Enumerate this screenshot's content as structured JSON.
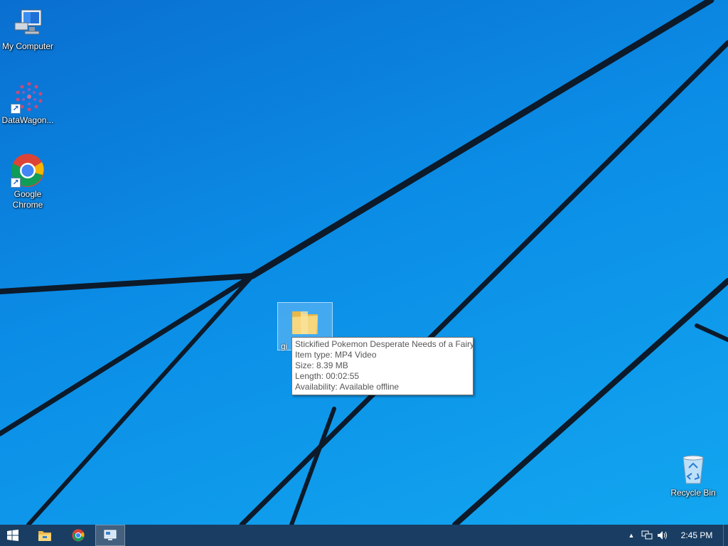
{
  "desktop": {
    "icons": [
      {
        "label": "My Computer"
      },
      {
        "label": "DataWagon..."
      },
      {
        "label": "Google Chrome"
      },
      {
        "label": "Recycle Bin"
      }
    ],
    "selected_item": {
      "label": "gi"
    }
  },
  "tooltip": {
    "title": "Stickified Pokemon Desperate Needs of a Fairy",
    "item_type": "Item type: MP4 Video",
    "size": "Size: 8.39 MB",
    "length": "Length: 00:02:55",
    "availability": "Availability: Available offline"
  },
  "taskbar": {
    "buttons": [
      {
        "icon": "windows-start-icon"
      },
      {
        "icon": "file-explorer-icon"
      },
      {
        "icon": "chrome-icon"
      },
      {
        "icon": "remote-desktop-icon"
      }
    ],
    "clock": "2:45 PM"
  },
  "colors": {
    "wallpaper_blue": "#0b8de6",
    "taskbar": "#1a3d63"
  }
}
